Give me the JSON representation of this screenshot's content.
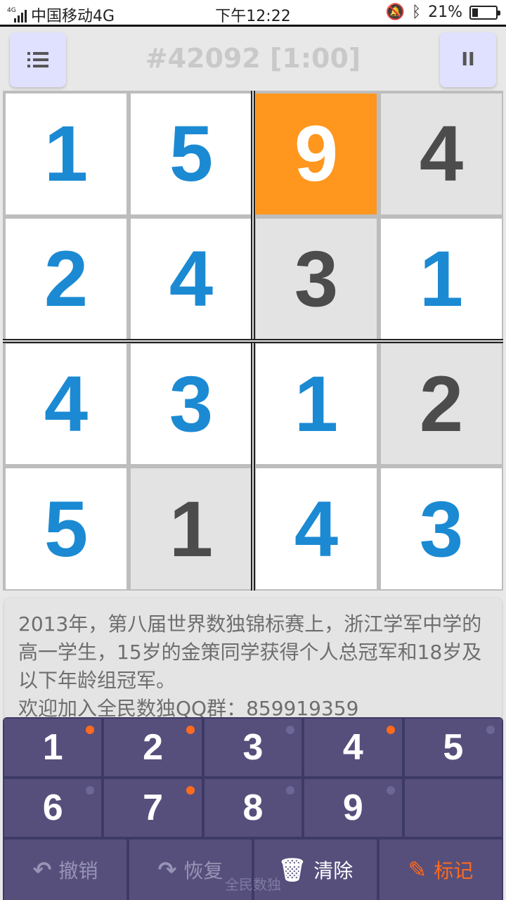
{
  "status_bar": {
    "signal_tag": "4G",
    "carrier": "中国移动4G",
    "time": "下午12:22",
    "battery_percent": "21%"
  },
  "header": {
    "title": "#42092 [1:00]",
    "menu_icon": "menu-icon",
    "pause_icon": "pause-icon",
    "pause_glyph": "II"
  },
  "board": {
    "size": 4,
    "cells": [
      {
        "value": "1",
        "type": "user"
      },
      {
        "value": "5",
        "type": "user"
      },
      {
        "value": "9",
        "type": "selected"
      },
      {
        "value": "4",
        "type": "given"
      },
      {
        "value": "2",
        "type": "user"
      },
      {
        "value": "4",
        "type": "user"
      },
      {
        "value": "3",
        "type": "given"
      },
      {
        "value": "1",
        "type": "user"
      },
      {
        "value": "4",
        "type": "user"
      },
      {
        "value": "3",
        "type": "user"
      },
      {
        "value": "1",
        "type": "user"
      },
      {
        "value": "2",
        "type": "given"
      },
      {
        "value": "5",
        "type": "user"
      },
      {
        "value": "1",
        "type": "given"
      },
      {
        "value": "4",
        "type": "user"
      },
      {
        "value": "3",
        "type": "user"
      }
    ]
  },
  "info": {
    "line1": "2013年，第八届世界数独锦标赛上，浙江学军中学的高一学生，15岁的金策同学获得个人总冠军和18岁及以下年龄组冠军。",
    "line2": "欢迎加入全民数独QQ群：859919359"
  },
  "keypad": {
    "keys": [
      {
        "label": "1",
        "marked": true
      },
      {
        "label": "2",
        "marked": true
      },
      {
        "label": "3",
        "marked": false
      },
      {
        "label": "4",
        "marked": true
      },
      {
        "label": "5",
        "marked": false
      },
      {
        "label": "6",
        "marked": false
      },
      {
        "label": "7",
        "marked": true
      },
      {
        "label": "8",
        "marked": false
      },
      {
        "label": "9",
        "marked": false
      }
    ],
    "actions": [
      {
        "label": "撤销",
        "icon": "undo-icon",
        "glyph": "↶"
      },
      {
        "label": "恢复",
        "icon": "redo-icon",
        "glyph": "↷"
      },
      {
        "label": "清除",
        "icon": "trash-icon",
        "glyph": "🗑"
      },
      {
        "label": "标记",
        "icon": "pencil-icon",
        "glyph": "✎"
      }
    ],
    "footer": "全民数独"
  },
  "colors": {
    "given_digit": "#4c4c4c",
    "user_digit": "#1b8ad3",
    "selected_bg": "#ff961e",
    "keypad_bg": "#3d3a66",
    "key_bg": "#564f7c",
    "mark_dot": "#ff6a1c"
  }
}
